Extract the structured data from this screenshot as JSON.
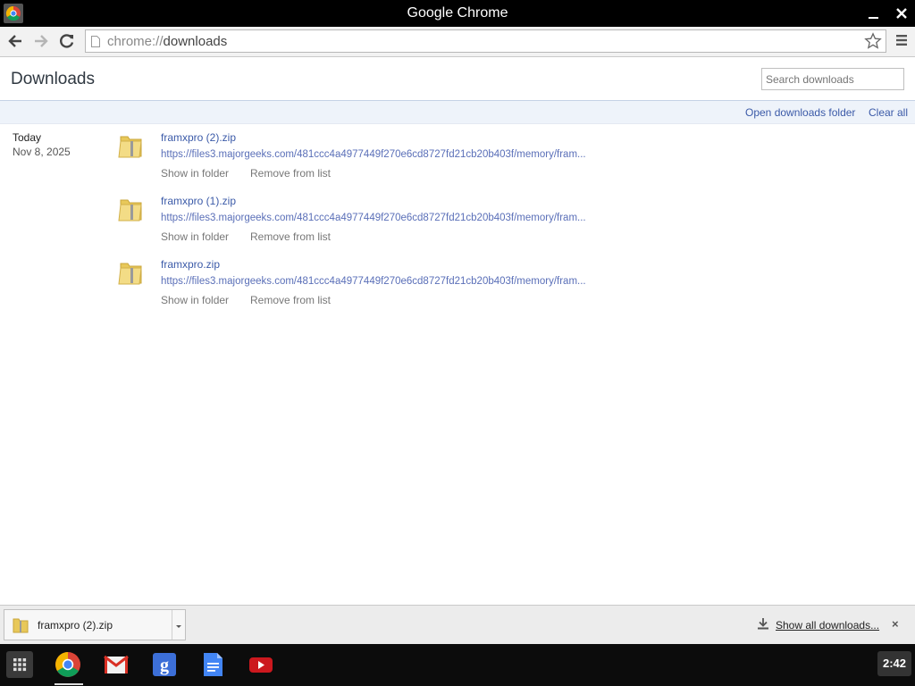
{
  "window": {
    "title": "Google Chrome"
  },
  "toolbar": {
    "url_scheme": "chrome://",
    "url_path": "downloads"
  },
  "page": {
    "title": "Downloads",
    "search_placeholder": "Search downloads",
    "open_folder_link": "Open downloads folder",
    "clear_all_link": "Clear all"
  },
  "date_group": {
    "day": "Today",
    "date": "Nov 8, 2025"
  },
  "downloads": [
    {
      "name": "framxpro (2).zip",
      "url": "https://files3.majorgeeks.com/481ccc4a4977449f270e6cd8727fd21cb20b403f/memory/fram...",
      "show_in_folder": "Show in folder",
      "remove": "Remove from list"
    },
    {
      "name": "framxpro (1).zip",
      "url": "https://files3.majorgeeks.com/481ccc4a4977449f270e6cd8727fd21cb20b403f/memory/fram...",
      "show_in_folder": "Show in folder",
      "remove": "Remove from list"
    },
    {
      "name": "framxpro.zip",
      "url": "https://files3.majorgeeks.com/481ccc4a4977449f270e6cd8727fd21cb20b403f/memory/fram...",
      "show_in_folder": "Show in folder",
      "remove": "Remove from list"
    }
  ],
  "shelf": {
    "item_name": "framxpro (2).zip",
    "show_all": "Show all downloads...",
    "close": "×"
  },
  "taskbar": {
    "apps": [
      "chrome-icon",
      "gmail-icon",
      "google-search-icon",
      "docs-icon",
      "youtube-icon"
    ],
    "clock": "2:42"
  },
  "colors": {
    "link": "#3b5aa8",
    "header_border": "#c5d2e6",
    "actionbar_bg": "#eef3fa"
  }
}
